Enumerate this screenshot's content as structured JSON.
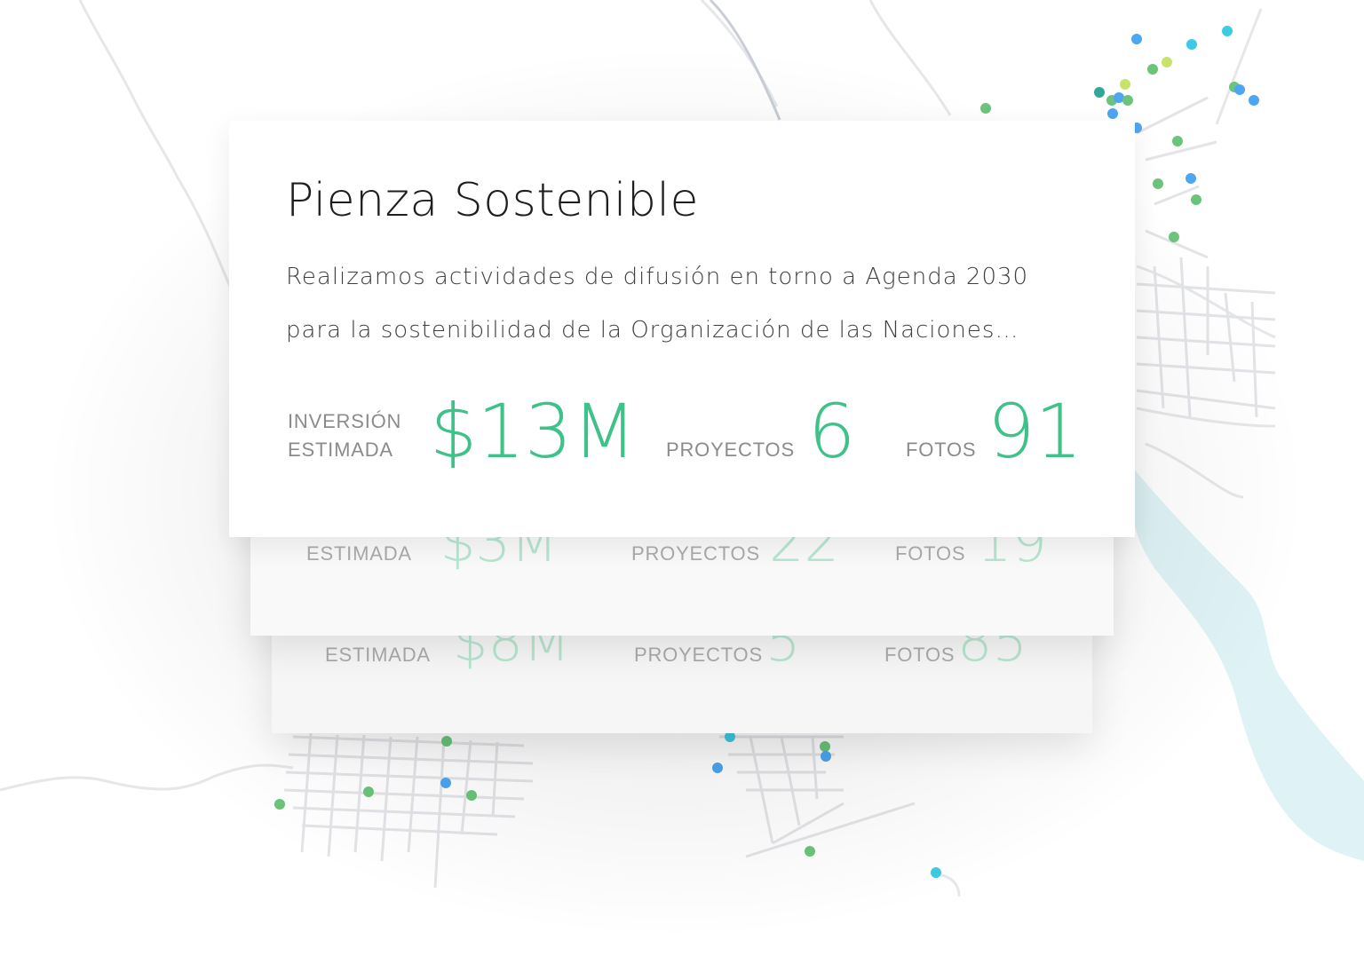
{
  "front_card": {
    "title": "Pienza Sostenible",
    "description_line1": "Realizamos actividades de difusión en torno a Agenda 2030",
    "description_line2": "para la sostenibilidad de la Organización de las Naciones…",
    "investment_label_1": "INVERSIÓN",
    "investment_label_2": "ESTIMADA",
    "investment_value": "$13M",
    "projects_label": "PROYECTOS",
    "projects_value": "6",
    "photos_label": "FOTOS",
    "photos_value": "91"
  },
  "back_card_1": {
    "investment_label": "ESTIMADA",
    "investment_value": "$3M",
    "projects_label": "PROYECTOS",
    "projects_value": "22",
    "photos_label": "FOTOS",
    "photos_value": "19"
  },
  "back_card_2": {
    "investment_label": "ESTIMADA",
    "investment_value": "$8M",
    "projects_label": "PROYECTOS",
    "projects_value": "5",
    "photos_label": "FOTOS",
    "photos_value": "85"
  },
  "colors": {
    "accent": "#3ec28a",
    "marker_green": "#6cc47a",
    "marker_blue": "#4da6f0",
    "marker_cyan": "#3ccbe4",
    "marker_lime": "#c8e36a",
    "marker_teal": "#2fa89a",
    "river": "#dff3f7",
    "road": "#e4e5e9"
  },
  "map": {
    "marker_legend_icons": [
      "map-marker-icon"
    ]
  }
}
